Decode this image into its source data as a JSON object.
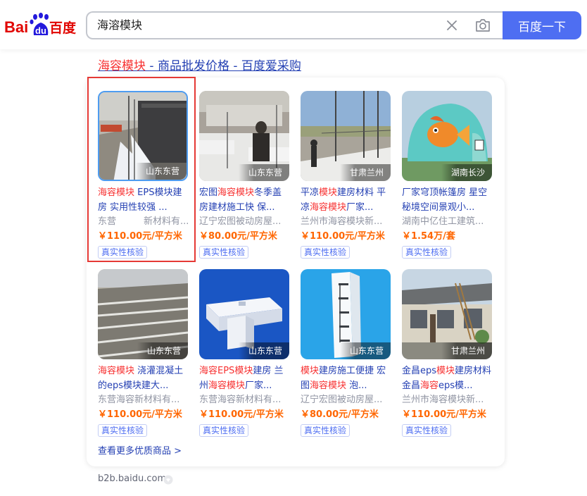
{
  "search": {
    "query": "海溶模块",
    "button_label": "百度一下"
  },
  "logo": {
    "text_bai": "Bai",
    "text_du": "du",
    "text_cn": "百度"
  },
  "result": {
    "title_hl": "海容模块",
    "title_rest": " - 商品批发价格 - 百度爱采购"
  },
  "products": [
    {
      "title_parts": [
        {
          "text": "海容模块",
          "hl": true
        },
        {
          "text": " EPS模块建房 实用性较强 ...",
          "hl": false
        }
      ],
      "seller": "东营　　　新材料有...",
      "price": "￥110.00元/平方米",
      "location": "山东东营",
      "tag": "真实性核验"
    },
    {
      "title_parts": [
        {
          "text": "宏图",
          "hl": false
        },
        {
          "text": "海容模块",
          "hl": true
        },
        {
          "text": "冬季盖房建材施工快 保...",
          "hl": false
        }
      ],
      "seller": "辽宁宏图被动房屋...",
      "price": "￥80.00元/平方米",
      "location": "山东东营",
      "tag": "真实性核验"
    },
    {
      "title_parts": [
        {
          "text": "平凉",
          "hl": false
        },
        {
          "text": "模块",
          "hl": true
        },
        {
          "text": "建房材料 平凉",
          "hl": false
        },
        {
          "text": "海容模块",
          "hl": true
        },
        {
          "text": "厂家...",
          "hl": false
        }
      ],
      "seller": "兰州市海容模块新...",
      "price": "￥110.00元/平方米",
      "location": "甘肃兰州",
      "tag": "真实性核验"
    },
    {
      "title_parts": [
        {
          "text": "厂家穹顶帐篷房 星空秘境空间景观小...",
          "hl": false
        }
      ],
      "seller": "湖南中亿住工建筑...",
      "price": "￥1.54万/套",
      "location": "湖南长沙",
      "tag": "真实性核验"
    },
    {
      "title_parts": [
        {
          "text": "海容模块",
          "hl": true
        },
        {
          "text": " 浇灌混凝土的eps模块建大...",
          "hl": false
        }
      ],
      "seller": "东营海容新材料有...",
      "price": "￥110.00元/平方米",
      "location": "山东东营",
      "tag": "真实性核验"
    },
    {
      "title_parts": [
        {
          "text": "海容EPS",
          "hl": true
        },
        {
          "text": "模块",
          "hl": true
        },
        {
          "text": "建房 兰州",
          "hl": false
        },
        {
          "text": "海容模块",
          "hl": true
        },
        {
          "text": "厂家...",
          "hl": false
        }
      ],
      "seller": "东营海容新材料有...",
      "price": "￥110.00元/平方米",
      "location": "山东东营",
      "tag": "真实性核验"
    },
    {
      "title_parts": [
        {
          "text": "模块",
          "hl": true
        },
        {
          "text": "建房施工便捷 宏图",
          "hl": false
        },
        {
          "text": "海容模块",
          "hl": true
        },
        {
          "text": " 泡...",
          "hl": false
        }
      ],
      "seller": "辽宁宏图被动房屋...",
      "price": "￥80.00元/平方米",
      "location": "山东东营",
      "tag": "真实性核验"
    },
    {
      "title_parts": [
        {
          "text": "金昌eps",
          "hl": false
        },
        {
          "text": "模块",
          "hl": true
        },
        {
          "text": "建房材料 金昌",
          "hl": false
        },
        {
          "text": "海容",
          "hl": true
        },
        {
          "text": "eps模...",
          "hl": false
        }
      ],
      "seller": "兰州市海容模块新...",
      "price": "￥110.00元/平方米",
      "location": "甘肃兰州",
      "tag": "真实性核验"
    }
  ],
  "more_link": "查看更多优质商品 >",
  "source": "b2b.baidu.com",
  "colors": {
    "link": "#2440b3",
    "highlight": "#f73131",
    "price": "#ff6600",
    "brand_blue": "#4e6ef2",
    "logo_red": "#e10602",
    "logo_blue": "#2319dc"
  }
}
